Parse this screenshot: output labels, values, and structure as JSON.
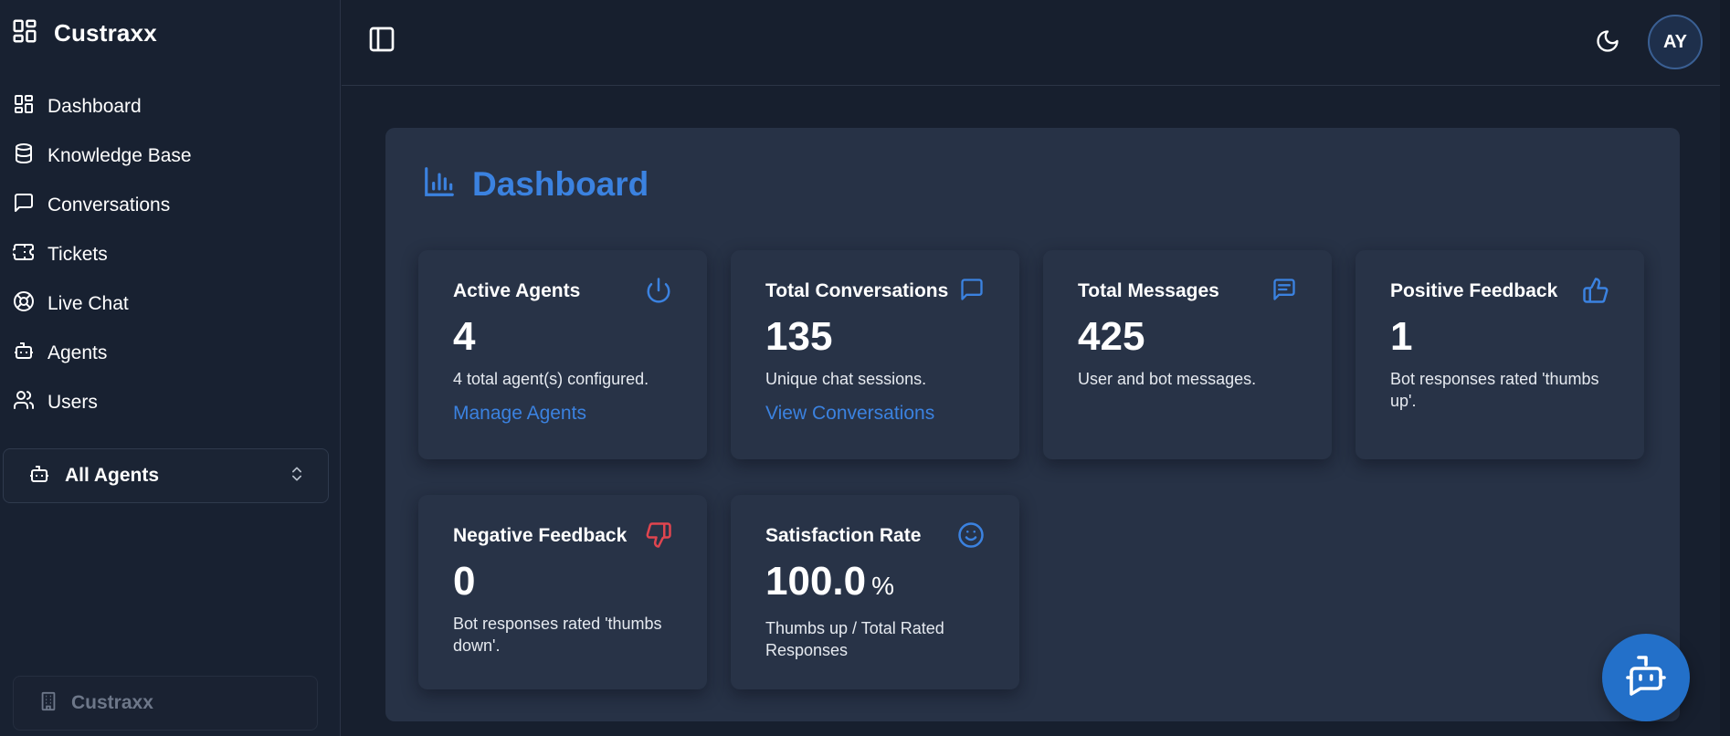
{
  "brand": {
    "name": "Custraxx"
  },
  "sidebar": {
    "items": [
      {
        "label": "Dashboard",
        "icon": "dashboard-icon"
      },
      {
        "label": "Knowledge Base",
        "icon": "database-icon"
      },
      {
        "label": "Conversations",
        "icon": "message-square-icon"
      },
      {
        "label": "Tickets",
        "icon": "ticket-icon"
      },
      {
        "label": "Live Chat",
        "icon": "lifebuoy-icon"
      },
      {
        "label": "Agents",
        "icon": "bot-icon"
      },
      {
        "label": "Users",
        "icon": "users-icon"
      }
    ],
    "agent_selector": {
      "value": "All Agents"
    },
    "org": {
      "name": "Custraxx"
    }
  },
  "header": {
    "avatar_initials": "AY"
  },
  "dashboard": {
    "title": "Dashboard",
    "cards": [
      {
        "title": "Active Agents",
        "value": "4",
        "desc": "4 total agent(s) configured.",
        "link": "Manage Agents",
        "icon": "power-icon"
      },
      {
        "title": "Total Conversations",
        "value": "135",
        "desc": "Unique chat sessions.",
        "link": "View Conversations",
        "icon": "message-square-icon"
      },
      {
        "title": "Total Messages",
        "value": "425",
        "desc": "User and bot messages.",
        "icon": "message-text-icon"
      },
      {
        "title": "Positive Feedback",
        "value": "1",
        "desc": "Bot responses rated 'thumbs up'.",
        "icon": "thumbs-up-icon"
      },
      {
        "title": "Negative Feedback",
        "value": "0",
        "desc": "Bot responses rated 'thumbs down'.",
        "icon": "thumbs-down-icon"
      },
      {
        "title": "Satisfaction Rate",
        "value": "100.0",
        "unit": "%",
        "desc": "Thumbs up / Total Rated Responses",
        "icon": "smile-icon"
      }
    ]
  },
  "colors": {
    "accent": "#3b82e0",
    "negative": "#e0454f",
    "background": "#171f2e",
    "panel": "#273246"
  }
}
